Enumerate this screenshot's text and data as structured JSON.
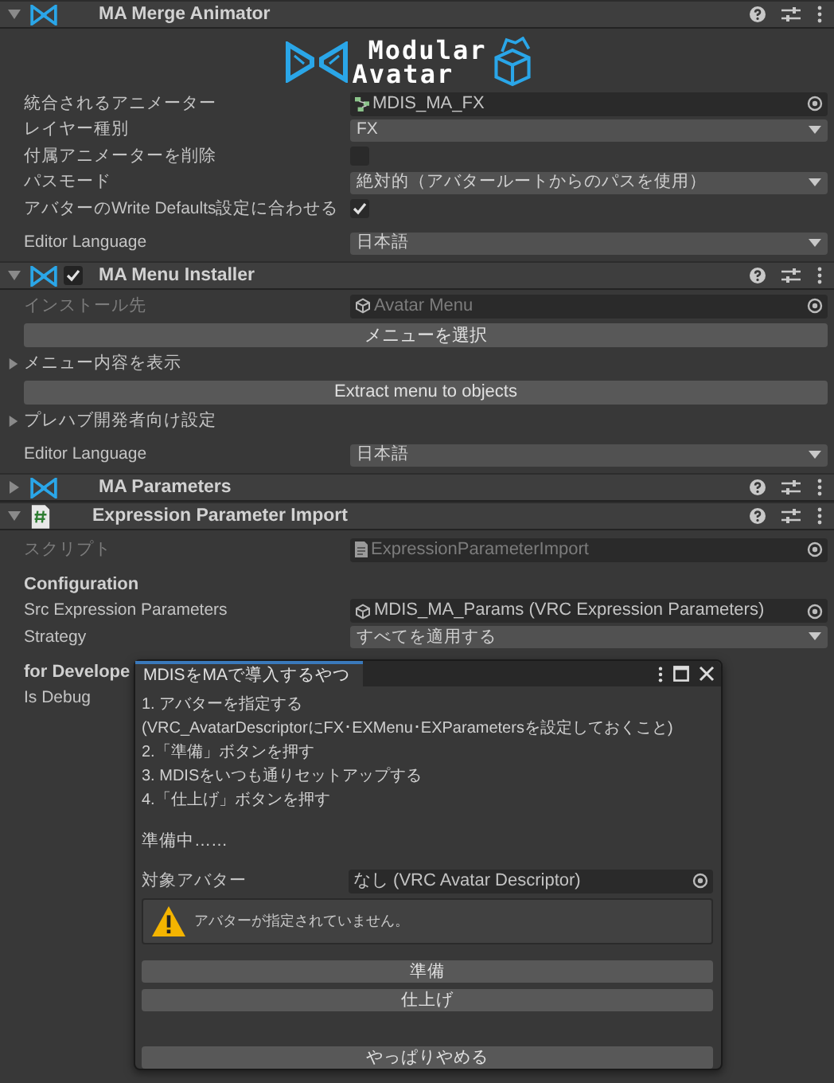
{
  "components": [
    {
      "title": "MA Merge Animator",
      "expanded": true,
      "logo": {
        "line1": "Modular",
        "line2": "Avatar"
      },
      "rows": [
        {
          "kind": "object_field",
          "label": "統合されるアニメーター",
          "value": "MDIS_MA_FX",
          "disabled": false
        },
        {
          "kind": "dropdown",
          "label": "レイヤー種別",
          "value": "FX"
        },
        {
          "kind": "checkbox",
          "label": "付属アニメーターを削除",
          "checked": false
        },
        {
          "kind": "dropdown",
          "label": "パスモード",
          "value": "絶対的（アバタールートからのパスを使用）"
        },
        {
          "kind": "checkbox",
          "label": "アバターのWrite Defaults設定に合わせる",
          "checked": true
        },
        {
          "kind": "dropdown",
          "label": "Editor Language",
          "value": "日本語"
        }
      ]
    },
    {
      "title": "MA Menu Installer",
      "expanded": true,
      "enabled": true,
      "rows": [
        {
          "kind": "object_field",
          "label": "インストール先",
          "value": "Avatar Menu",
          "disabled": true
        },
        {
          "kind": "button",
          "label": "メニューを選択"
        },
        {
          "kind": "foldout",
          "label": "メニュー内容を表示",
          "expanded": false
        },
        {
          "kind": "button",
          "label": "Extract menu to objects"
        },
        {
          "kind": "foldout",
          "label": "プレハブ開発者向け設定",
          "expanded": false
        },
        {
          "kind": "dropdown",
          "label": "Editor Language",
          "value": "日本語"
        }
      ]
    },
    {
      "title": "MA Parameters",
      "expanded": false
    },
    {
      "title": "Expression Parameter Import",
      "expanded": true,
      "rows": [
        {
          "kind": "object_field",
          "label": "スクリプト",
          "value": "ExpressionParameterImport",
          "disabled": true
        },
        {
          "kind": "heading",
          "label": "Configuration"
        },
        {
          "kind": "object_field",
          "label": "Src Expression Parameters",
          "value": "MDIS_MA_Params (VRC Expression Parameters)",
          "disabled": false
        },
        {
          "kind": "dropdown",
          "label": "Strategy",
          "value": "すべてを適用する"
        },
        {
          "kind": "heading",
          "label": "for Develope"
        },
        {
          "kind": "text",
          "label": "Is Debug"
        }
      ]
    }
  ],
  "dialog": {
    "title": "MDISをMAで導入するやつ",
    "instructions": [
      "1. アバターを指定する",
      "(VRC_AvatarDescriptorにFX･EXMenu･EXParametersを設定しておくこと)",
      "2.「準備」ボタンを押す",
      "3. MDISをいつも通りセットアップする",
      "4.「仕上げ」ボタンを押す"
    ],
    "status": "準備中……",
    "target": {
      "label": "対象アバター",
      "value": "なし (VRC Avatar Descriptor)"
    },
    "warning": "アバターが指定されていません。",
    "buttons": [
      "準備",
      "仕上げ",
      "やっぱりやめる"
    ]
  }
}
